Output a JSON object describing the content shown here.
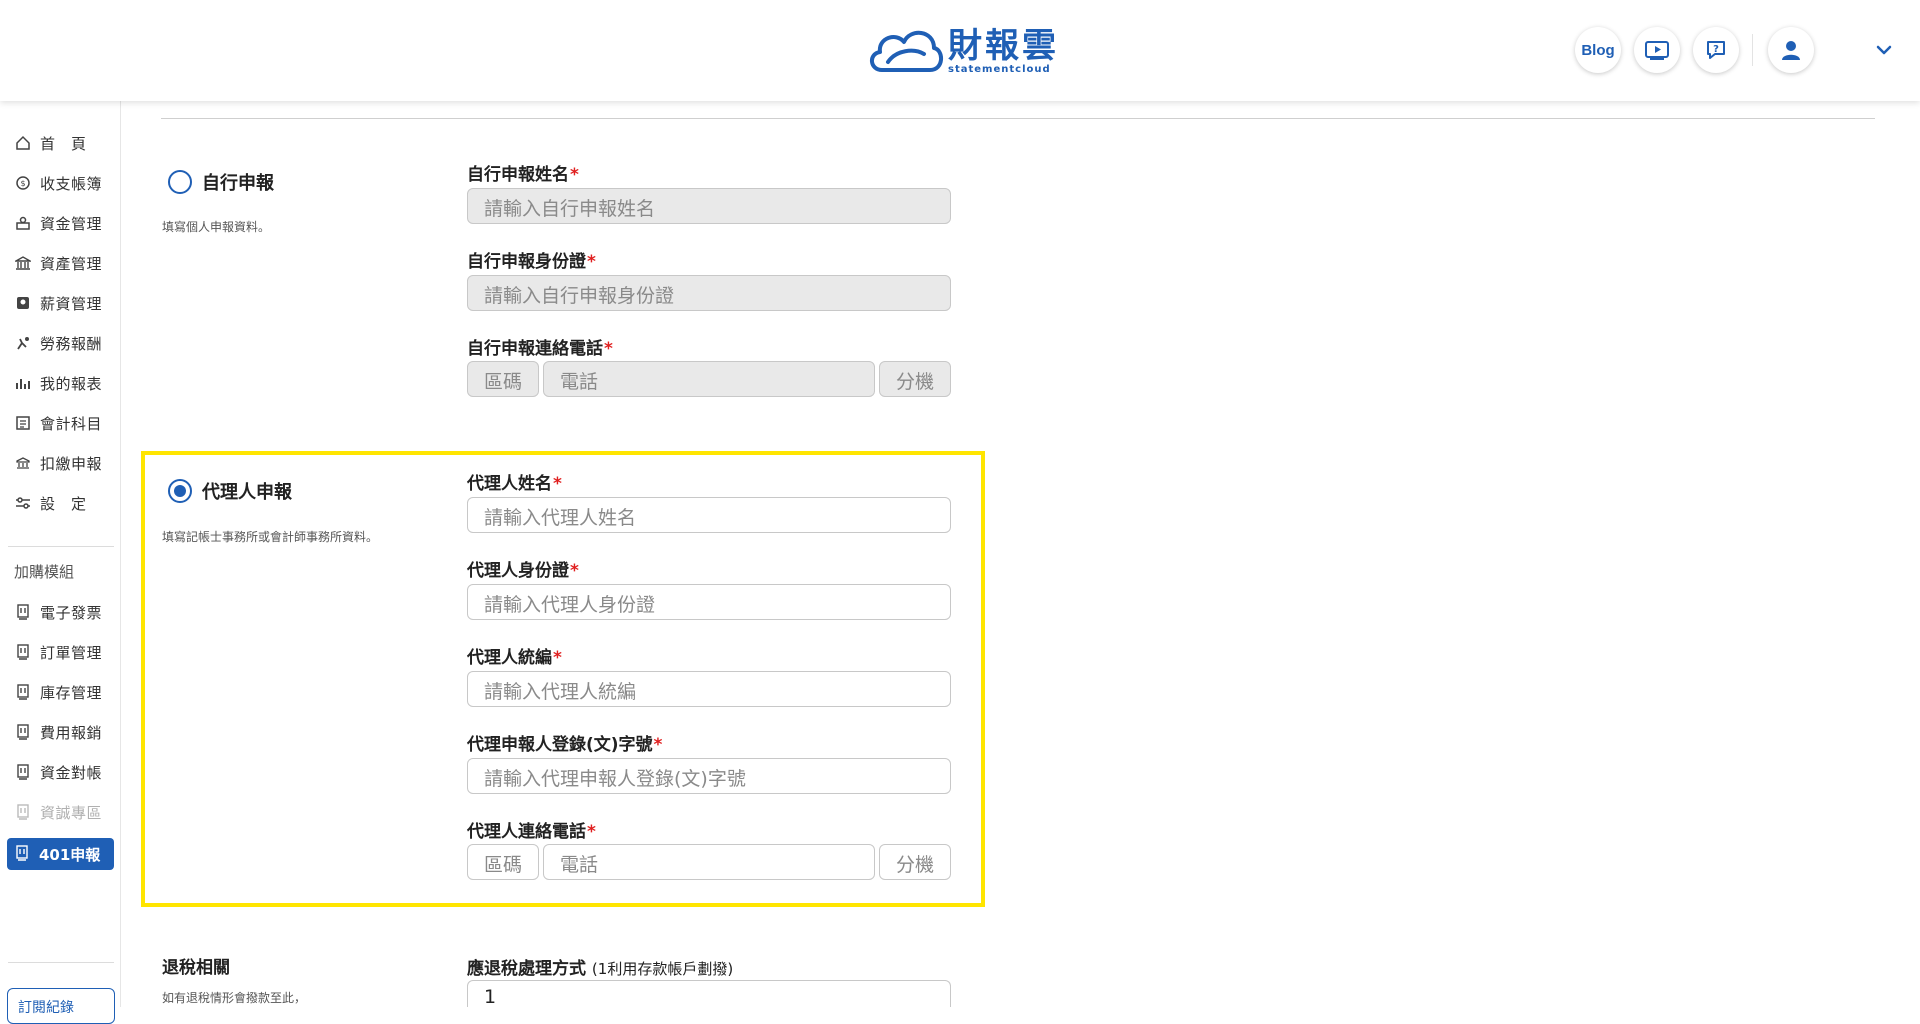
{
  "header": {
    "logo_text": "財報雲",
    "logo_sub": "statementcloud",
    "blog_label": "Blog",
    "icons": [
      "video-book-icon",
      "help-chat-icon",
      "user-avatar-icon",
      "chevron-down-icon"
    ]
  },
  "sidebar": {
    "items": [
      {
        "label": "首　頁",
        "icon": "home-icon"
      },
      {
        "label": "收支帳簿",
        "icon": "coin-icon"
      },
      {
        "label": "資金管理",
        "icon": "money-hand-icon"
      },
      {
        "label": "資產管理",
        "icon": "bank-icon"
      },
      {
        "label": "薪資管理",
        "icon": "payroll-icon"
      },
      {
        "label": "勞務報酬",
        "icon": "service-icon"
      },
      {
        "label": "我的報表",
        "icon": "chart-icon"
      },
      {
        "label": "會計科目",
        "icon": "ledger-icon"
      },
      {
        "label": "扣繳申報",
        "icon": "tax-icon"
      },
      {
        "label": "設　定",
        "icon": "settings-icon"
      }
    ],
    "addon_title": "加購模組",
    "addons": [
      {
        "label": "電子發票",
        "icon": "module-icon"
      },
      {
        "label": "訂單管理",
        "icon": "module-icon"
      },
      {
        "label": "庫存管理",
        "icon": "module-icon"
      },
      {
        "label": "費用報銷",
        "icon": "module-icon"
      },
      {
        "label": "資金對帳",
        "icon": "module-icon"
      },
      {
        "label": "資誠專區",
        "icon": "module-icon"
      }
    ],
    "active": {
      "label": "401申報",
      "icon": "module-icon"
    },
    "subscription_label": "訂閱紀錄"
  },
  "self_report": {
    "option_label": "自行申報",
    "description": "填寫個人申報資料。",
    "name_label": "自行申報姓名",
    "name_placeholder": "請輸入自行申報姓名",
    "id_label": "自行申報身份證",
    "id_placeholder": "請輸入自行申報身份證",
    "phone_label": "自行申報連絡電話",
    "area_placeholder": "區碼",
    "phone_placeholder": "電話",
    "ext_placeholder": "分機"
  },
  "agent_report": {
    "option_label": "代理人申報",
    "description": "填寫記帳士事務所或會計師事務所資料。",
    "name_label": "代理人姓名",
    "name_placeholder": "請輸入代理人姓名",
    "id_label": "代理人身份證",
    "id_placeholder": "請輸入代理人身份證",
    "tax_id_label": "代理人統編",
    "tax_id_placeholder": "請輸入代理人統編",
    "reg_label": "代理申報人登錄(文)字號",
    "reg_placeholder": "請輸入代理申報人登錄(文)字號",
    "phone_label": "代理人連絡電話",
    "area_placeholder": "區碼",
    "phone_placeholder": "電話",
    "ext_placeholder": "分機"
  },
  "refund": {
    "title": "退稅相關",
    "description": "如有退稅情形會撥款至此，",
    "method_label": "應退稅處理方式",
    "method_hint": "(1利用存款帳戶劃撥)",
    "method_value": "1"
  },
  "required_mark": "*"
}
